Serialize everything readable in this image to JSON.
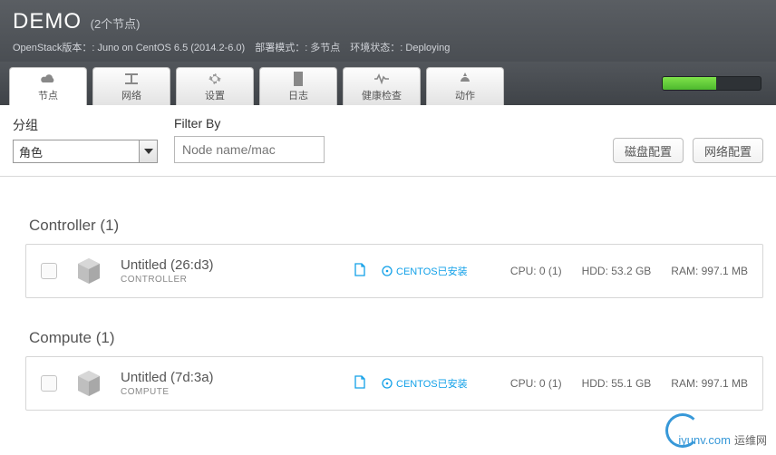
{
  "header": {
    "title": "DEMO",
    "subtitle": "(2个节点)",
    "meta": "OpenStack版本：: Juno on CentOS 6.5 (2014.2-6.0)　部署模式：: 多节点　环境状态：: Deploying"
  },
  "tabs": [
    {
      "label": "节点",
      "icon": "cloud-icon",
      "active": true
    },
    {
      "label": "网络",
      "icon": "network-icon",
      "active": false
    },
    {
      "label": "设置",
      "icon": "gear-icon",
      "active": false
    },
    {
      "label": "日志",
      "icon": "log-icon",
      "active": false
    },
    {
      "label": "健康检查",
      "icon": "heart-icon",
      "active": false
    },
    {
      "label": "动作",
      "icon": "bolt-icon",
      "active": false
    }
  ],
  "progress": {
    "pct": 55
  },
  "toolbar": {
    "group_label": "分组",
    "group_value": "角色",
    "filter_label": "Filter By",
    "filter_placeholder": "Node name/mac",
    "disk_btn": "磁盘配置",
    "net_btn": "网络配置"
  },
  "sections": [
    {
      "title": "Controller (1)",
      "node": {
        "name": "Untitled (26:d3)",
        "role": "CONTROLLER",
        "os": "CENTOS已安装",
        "cpu": "CPU: 0 (1)",
        "hdd": "HDD: 53.2 GB",
        "ram": "RAM: 997.1 MB"
      }
    },
    {
      "title": "Compute (1)",
      "node": {
        "name": "Untitled (7d:3a)",
        "role": "COMPUTE",
        "os": "CENTOS已安装",
        "cpu": "CPU: 0 (1)",
        "hdd": "HDD: 55.1 GB",
        "ram": "RAM: 997.1 MB"
      }
    }
  ],
  "watermark": {
    "text": "iyunv.com",
    "cn": "运维网"
  }
}
